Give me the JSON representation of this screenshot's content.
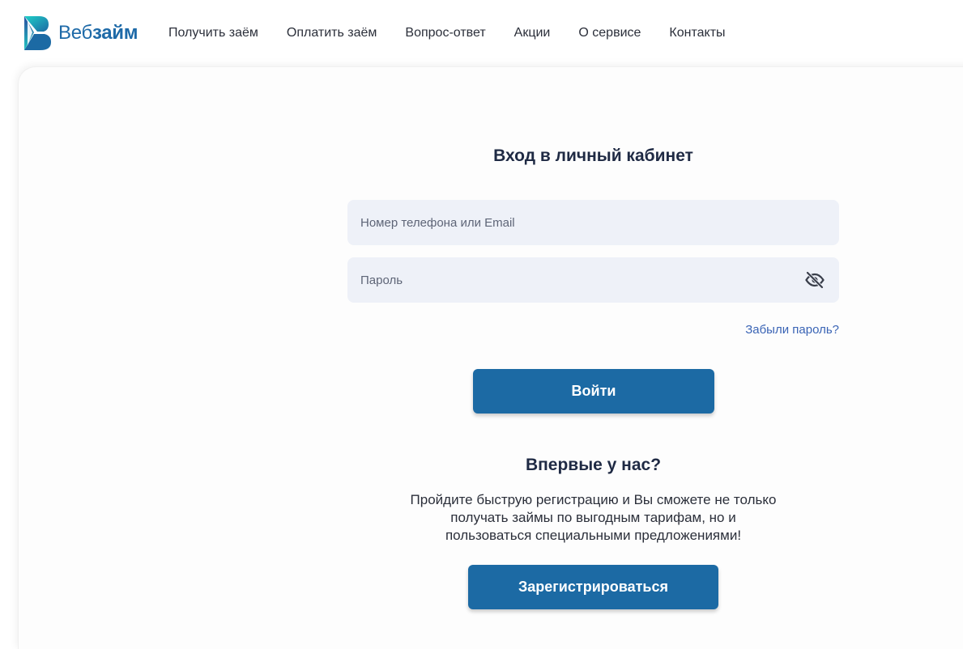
{
  "header": {
    "logo": {
      "text_regular": "Веб",
      "text_bold": "займ",
      "icon": "webzaim-logo-mark"
    },
    "nav": [
      {
        "label": "Получить заём"
      },
      {
        "label": "Оплатить заём"
      },
      {
        "label": "Вопрос-ответ"
      },
      {
        "label": "Акции"
      },
      {
        "label": "О сервисе"
      },
      {
        "label": "Контакты"
      }
    ]
  },
  "login": {
    "title": "Вход в личный кабинет",
    "phone_placeholder": "Номер телефона или Email",
    "phone_value": "",
    "password_placeholder": "Пароль",
    "password_value": "",
    "password_toggle_icon": "eye-off-icon",
    "forgot_label": "Забыли пароль?",
    "submit_label": "Войти"
  },
  "register": {
    "title": "Впервые у нас?",
    "description": "Пройдите быструю регистрацию и Вы сможете не только получать займы по выгодным тарифам, но и пользоваться специальными предложениями!",
    "button_label": "Зарегистрироваться"
  },
  "colors": {
    "brand": "#1e6aa8",
    "button": "#1c6aa4",
    "link": "#3a64b5",
    "field_bg": "#eef1f8",
    "text": "#1f2a44"
  }
}
